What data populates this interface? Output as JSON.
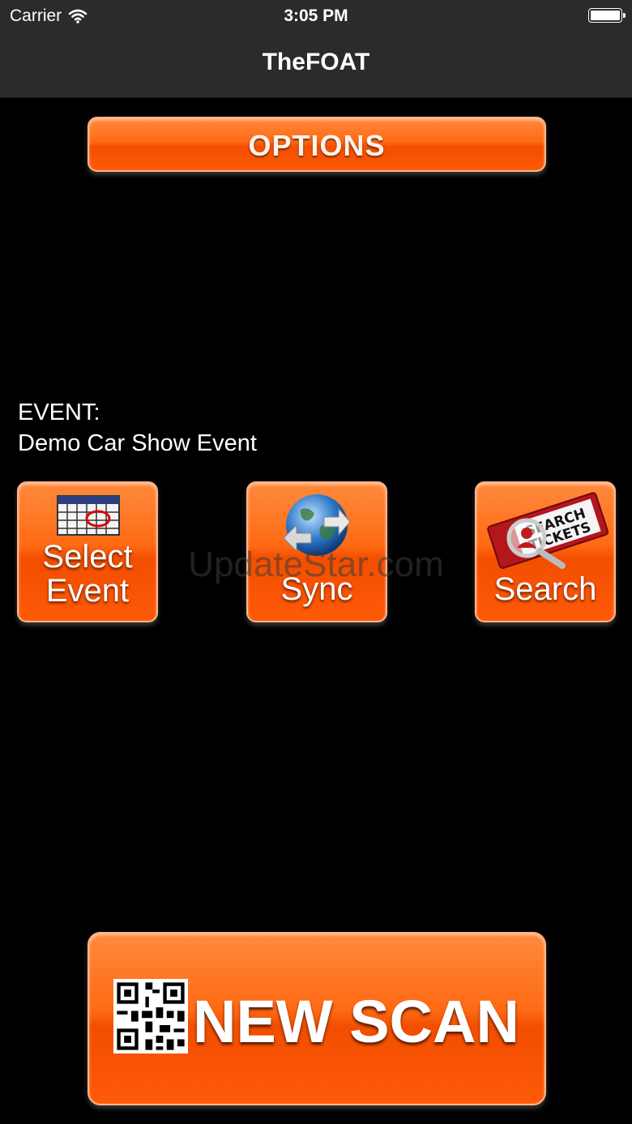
{
  "status_bar": {
    "carrier": "Carrier",
    "time": "3:05 PM"
  },
  "nav": {
    "title": "TheFOAT"
  },
  "options_button": {
    "label": "OPTIONS"
  },
  "event": {
    "label": "EVENT:",
    "name": "Demo Car Show Event"
  },
  "actions": {
    "select_event": {
      "line1": "Select",
      "line2": "Event",
      "icon": "calendar-icon"
    },
    "sync": {
      "label": "Sync",
      "icon": "globe-sync-icon"
    },
    "search": {
      "label": "Search",
      "icon": "search-tickets-icon",
      "icon_text_1": "SEARCH",
      "icon_text_2": "TICKETS"
    }
  },
  "watermark": "UpdateStar.com",
  "scan_button": {
    "label": "NEW SCAN",
    "icon": "qr-code-icon"
  },
  "colors": {
    "accent": "#ff5a08",
    "bar": "#2b2b2d",
    "background": "#000000"
  }
}
